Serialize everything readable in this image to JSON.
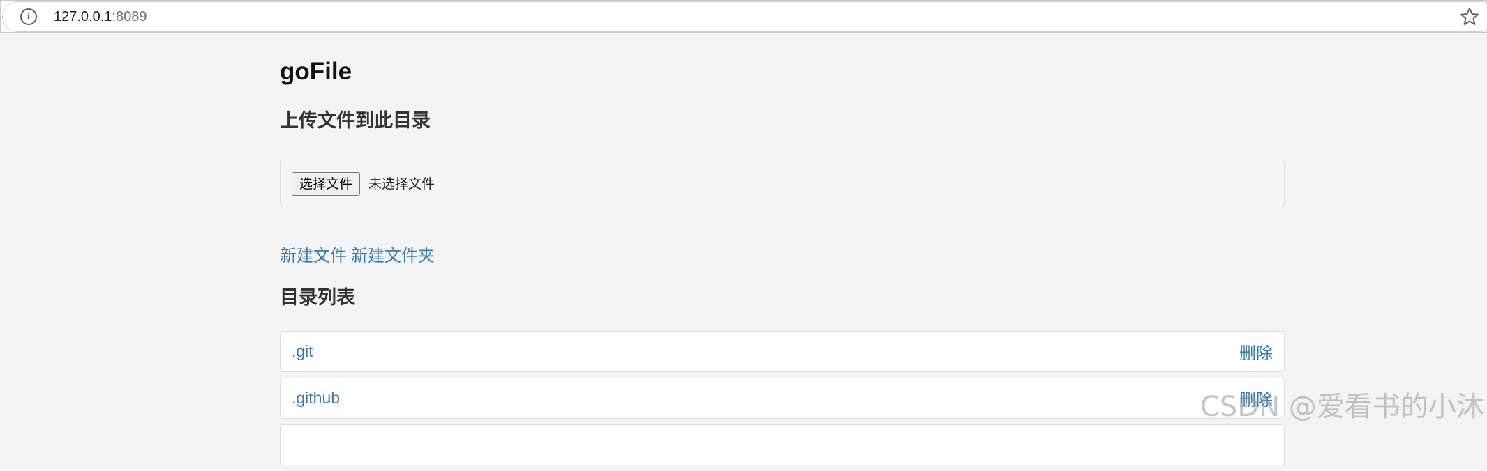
{
  "browser": {
    "url_host": "127.0.0.1",
    "url_port": ":8089"
  },
  "page": {
    "title": "goFile",
    "upload_heading": "上传文件到此目录",
    "file_button_label": "选择文件",
    "file_status": "未选择文件",
    "new_file_link": "新建文件",
    "new_folder_link": "新建文件夹",
    "list_heading": "目录列表"
  },
  "entries": [
    {
      "name": ".git",
      "delete_label": "删除"
    },
    {
      "name": ".github",
      "delete_label": "删除"
    }
  ],
  "watermark": "CSDN @爱看书的小沐",
  "colors": {
    "link": "#337ab7",
    "background": "#f3f3f3"
  },
  "icons": {
    "info": "info-icon",
    "bookmark": "star-icon"
  }
}
